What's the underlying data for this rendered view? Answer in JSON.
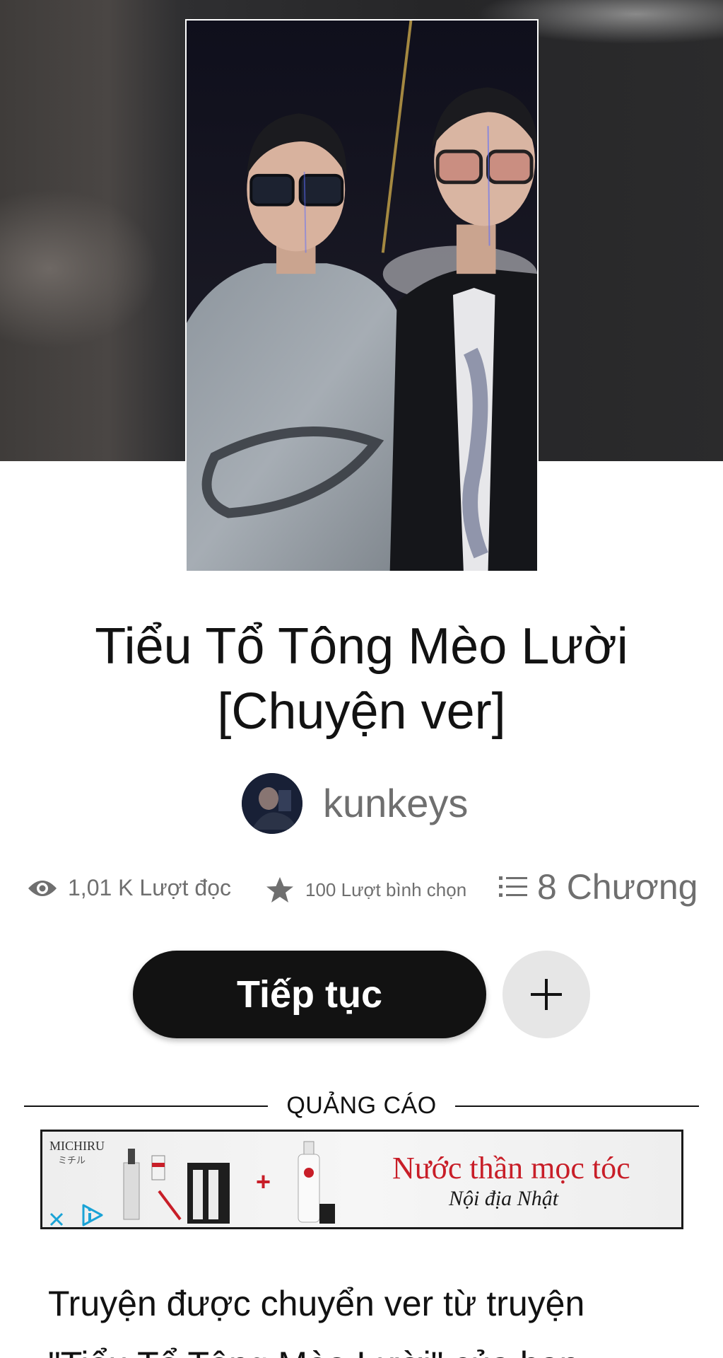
{
  "story": {
    "title_line1": "Tiểu Tổ Tông Mèo Lười",
    "title_line2": "[Chuyện ver]",
    "author": "kunkeys",
    "stats": {
      "reads": "1,01 K Lượt đọc",
      "votes": "100 Lượt bình chọn",
      "parts": "8 Chương"
    },
    "description_line1": "Truyện được chuyển ver từ truyện",
    "description_line2": "\"Tiểu Tổ Tông Mèo Lười\" của bạn"
  },
  "actions": {
    "continue_label": "Tiếp tục",
    "add_icon": "plus-icon"
  },
  "ad": {
    "label": "QUẢNG CÁO",
    "brand": "MICHIRU",
    "brand_sub": "ミチル",
    "headline": "Nước thần mọc tóc",
    "subline": "Nội địa Nhật",
    "plus": "+"
  },
  "icons": {
    "reads": "eye-icon",
    "votes": "star-icon",
    "parts": "list-icon",
    "close": "close-icon",
    "info": "ad-info-icon"
  },
  "colors": {
    "text_primary": "#121212",
    "text_muted": "#6f6f6f",
    "button_dark": "#121212",
    "button_light": "#e6e6e6",
    "ad_red": "#c81e28",
    "ad_info_blue": "#1aa3d6"
  }
}
